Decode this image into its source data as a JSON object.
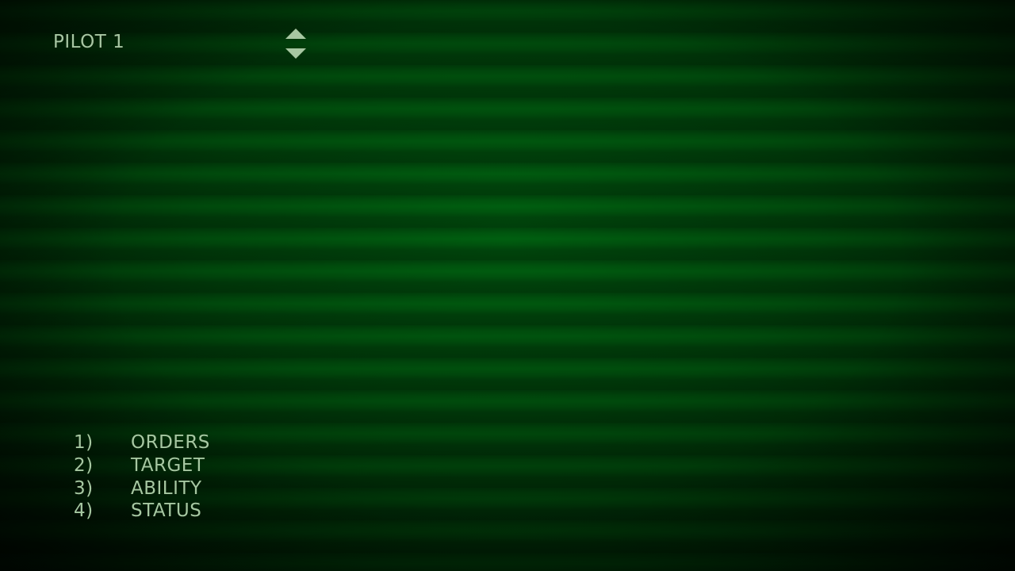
{
  "header": {
    "pilot_label": "PILOT 1"
  },
  "selector": {
    "up_icon": "triangle-up",
    "down_icon": "triangle-down"
  },
  "menu": {
    "items": [
      {
        "num": "1)",
        "label": "ORDERS"
      },
      {
        "num": "2)",
        "label": "TARGET"
      },
      {
        "num": "3)",
        "label": "ABILITY"
      },
      {
        "num": "4)",
        "label": "STATUS"
      }
    ]
  },
  "colors": {
    "text": "#a7c7a2",
    "background_center": "#006010",
    "background_edge": "#000e02"
  }
}
